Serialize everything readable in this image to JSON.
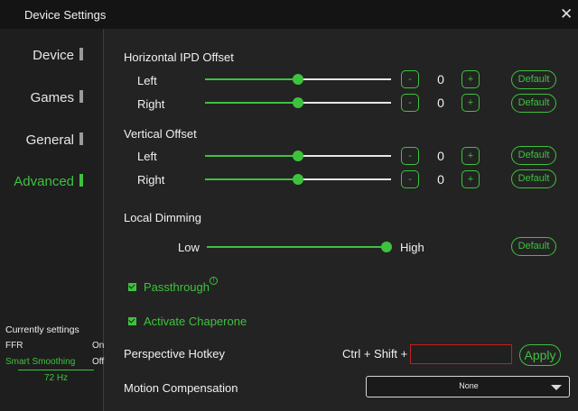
{
  "window": {
    "title": "Device Settings",
    "close_glyph": "✕"
  },
  "sidebar": {
    "items": [
      {
        "label": "Device",
        "active": false
      },
      {
        "label": "Games",
        "active": false
      },
      {
        "label": "General",
        "active": false
      },
      {
        "label": "Advanced",
        "active": true
      }
    ]
  },
  "status_panel": {
    "heading": "Currently settings",
    "rows": [
      {
        "name": "FFR",
        "value": "On"
      },
      {
        "name": "Smart Smoothing",
        "value": "Off"
      }
    ],
    "refresh_rate": "72 Hz"
  },
  "horizontal_ipd": {
    "title": "Horizontal IPD Offset",
    "left": {
      "label": "Left",
      "value": "0",
      "level": 0.5
    },
    "right": {
      "label": "Right",
      "value": "0",
      "level": 0.5
    }
  },
  "vertical_offset": {
    "title": "Vertical Offset",
    "left": {
      "label": "Left",
      "value": "0",
      "level": 0.5
    },
    "right": {
      "label": "Right",
      "value": "0",
      "level": 0.5
    }
  },
  "controls": {
    "minus": "-",
    "plus": "+",
    "default": "Default"
  },
  "local_dimming": {
    "title": "Local Dimming",
    "low": "Low",
    "high": "High",
    "level": 1.0
  },
  "checkboxes": [
    {
      "label": "Passthrough",
      "checked": true,
      "info": "!"
    },
    {
      "label": "Activate Chaperone",
      "checked": true
    }
  ],
  "hotkey": {
    "label": "Perspective Hotkey",
    "prefix": "Ctrl + Shift +",
    "value": "",
    "apply": "Apply"
  },
  "motion_compensation": {
    "label": "Motion Compensation",
    "selected": "None"
  },
  "colors": {
    "accent": "#3ec23e",
    "error_border": "#c41e1e",
    "background": "#232323"
  }
}
